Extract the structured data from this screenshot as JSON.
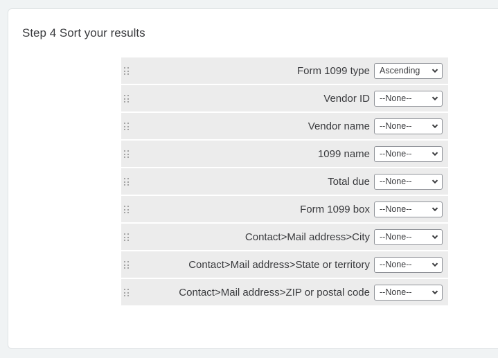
{
  "section": {
    "title": "Step 4 Sort your results"
  },
  "sort_fields": [
    {
      "label": "Form 1099 type",
      "value": "Ascending"
    },
    {
      "label": "Vendor ID",
      "value": "--None--"
    },
    {
      "label": "Vendor name",
      "value": "--None--"
    },
    {
      "label": "1099 name",
      "value": "--None--"
    },
    {
      "label": "Total due",
      "value": "--None--"
    },
    {
      "label": "Form 1099 box",
      "value": "--None--"
    },
    {
      "label": "Contact>Mail address>City",
      "value": "--None--"
    },
    {
      "label": "Contact>Mail address>State or territory",
      "value": "--None--"
    },
    {
      "label": "Contact>Mail address>ZIP or postal code",
      "value": "--None--"
    }
  ],
  "icons": {
    "drag_handle": "drag-handle-icon",
    "dropdown": "chevron-down-icon"
  }
}
